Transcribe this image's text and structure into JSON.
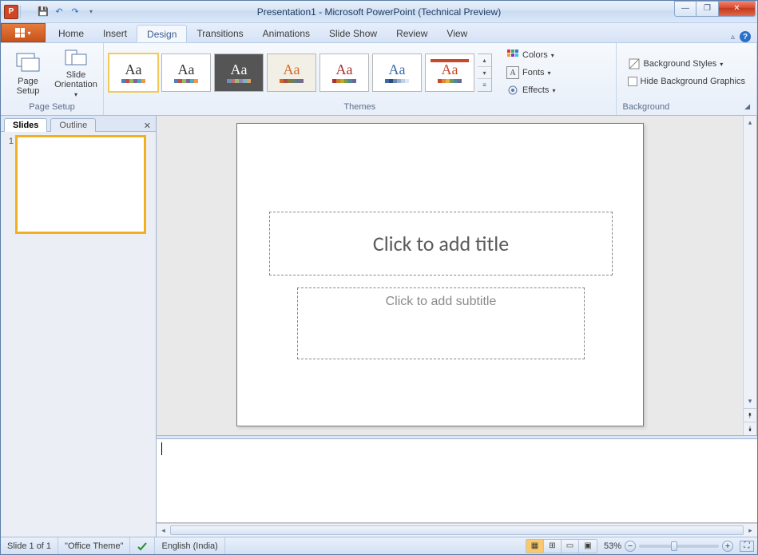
{
  "window": {
    "title": "Presentation1 - Microsoft PowerPoint (Technical Preview)"
  },
  "qat": {
    "save": "💾",
    "undo": "↶",
    "redo": "↷",
    "more": "▾"
  },
  "tabs": {
    "home": "Home",
    "insert": "Insert",
    "design": "Design",
    "transitions": "Transitions",
    "animations": "Animations",
    "slideshow": "Slide Show",
    "review": "Review",
    "view": "View"
  },
  "ribbon": {
    "page_setup_group": "Page Setup",
    "page_setup": "Page\nSetup",
    "slide_orientation": "Slide\nOrientation",
    "themes_group": "Themes",
    "colors": "Colors",
    "fonts": "Fonts",
    "effects": "Effects",
    "background_group": "Background",
    "background_styles": "Background Styles",
    "hide_bg": "Hide Background Graphics"
  },
  "themes": [
    {
      "bg": "#ffffff",
      "fg": "#333333",
      "swatches": [
        "#4f81bd",
        "#c0504d",
        "#9bbb59",
        "#8064a2",
        "#4bacc6",
        "#f79646"
      ]
    },
    {
      "bg": "#ffffff",
      "fg": "#333333",
      "swatches": [
        "#4f81bd",
        "#c0504d",
        "#9bbb59",
        "#8064a2",
        "#4bacc6",
        "#f79646"
      ]
    },
    {
      "bg": "#555555",
      "fg": "#ffffff",
      "swatches": [
        "#6f8db7",
        "#b87272",
        "#a1b878",
        "#9283b0",
        "#77b4c4",
        "#e0a064"
      ]
    },
    {
      "bg": "#f2efe6",
      "fg": "#d06a28",
      "swatches": [
        "#d06a28",
        "#a8513e",
        "#8a7a3a",
        "#6a8060",
        "#5a7a8a",
        "#7a6a8a"
      ]
    },
    {
      "bg": "#ffffff",
      "fg": "#a8322d",
      "swatches": [
        "#a8322d",
        "#d07a2a",
        "#c4a82a",
        "#7a9a4a",
        "#4a8a9a",
        "#6a6a9a"
      ]
    },
    {
      "bg": "#ffffff",
      "fg": "#3a6aa8",
      "swatches": [
        "#3a6aa8",
        "#2a4a78",
        "#6a8ab8",
        "#9ab0d0",
        "#c0d0e8",
        "#e0e8f4"
      ]
    },
    {
      "bg": "#ffffff",
      "fg": "#c84a2a",
      "swatches": [
        "#c84a2a",
        "#e0883a",
        "#e8b04a",
        "#7a9a4a",
        "#4a8a9a",
        "#6a6a9a"
      ],
      "accent_bar": "#c84a2a"
    }
  ],
  "left_pane": {
    "slides_tab": "Slides",
    "outline_tab": "Outline",
    "thumb_number": "1"
  },
  "slide": {
    "title_placeholder": "Click to add title",
    "subtitle_placeholder": "Click to add subtitle"
  },
  "status": {
    "slide_count": "Slide 1 of 1",
    "theme": "\"Office Theme\"",
    "language": "English (India)",
    "zoom": "53%"
  }
}
